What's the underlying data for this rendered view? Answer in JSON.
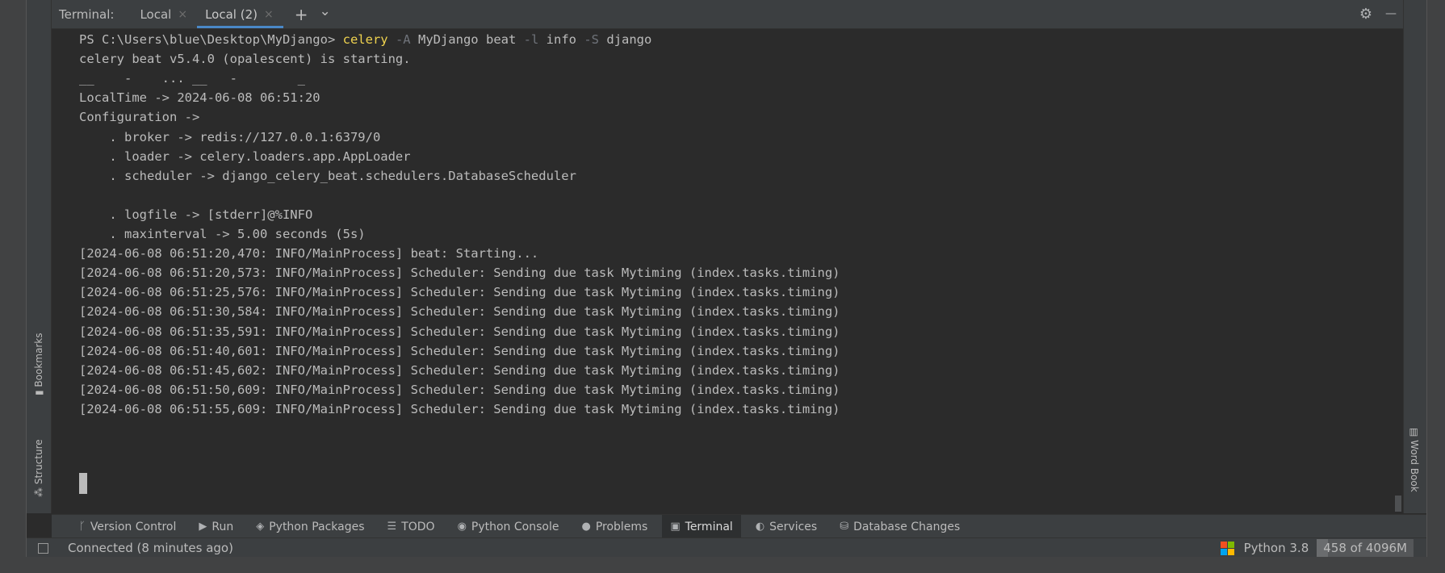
{
  "tabbar": {
    "title": "Terminal:",
    "tabs": [
      {
        "label": "Local",
        "close": "×",
        "active": false
      },
      {
        "label": "Local (2)",
        "close": "×",
        "active": true
      }
    ],
    "add_icon": "+",
    "dropdown_icon": "⌄",
    "settings_icon": "⚙",
    "minimize_icon": "—"
  },
  "side": {
    "bookmarks": "Bookmarks",
    "structure": "Structure",
    "word_book": "Word Book"
  },
  "terminal": {
    "prompt": "PS C:\\Users\\blue\\Desktop\\MyDjango>",
    "cmd": {
      "celery": "celery",
      "flag_a": "-A",
      "app": "MyDjango",
      "beat": "beat",
      "flag_l": "-l",
      "level": "info",
      "flag_s": "-S",
      "sched": "django"
    },
    "lines": [
      "celery beat v5.4.0 (opalescent) is starting.",
      "__    -    ... __   -        _",
      "LocalTime -> 2024-06-08 06:51:20",
      "Configuration ->",
      "    . broker -> redis://127.0.0.1:6379/0",
      "    . loader -> celery.loaders.app.AppLoader",
      "    . scheduler -> django_celery_beat.schedulers.DatabaseScheduler",
      "",
      "    . logfile -> [stderr]@%INFO",
      "    . maxinterval -> 5.00 seconds (5s)",
      "[2024-06-08 06:51:20,470: INFO/MainProcess] beat: Starting...",
      "[2024-06-08 06:51:20,573: INFO/MainProcess] Scheduler: Sending due task Mytiming (index.tasks.timing)",
      "[2024-06-08 06:51:25,576: INFO/MainProcess] Scheduler: Sending due task Mytiming (index.tasks.timing)",
      "[2024-06-08 06:51:30,584: INFO/MainProcess] Scheduler: Sending due task Mytiming (index.tasks.timing)",
      "[2024-06-08 06:51:35,591: INFO/MainProcess] Scheduler: Sending due task Mytiming (index.tasks.timing)",
      "[2024-06-08 06:51:40,601: INFO/MainProcess] Scheduler: Sending due task Mytiming (index.tasks.timing)",
      "[2024-06-08 06:51:45,602: INFO/MainProcess] Scheduler: Sending due task Mytiming (index.tasks.timing)",
      "[2024-06-08 06:51:50,609: INFO/MainProcess] Scheduler: Sending due task Mytiming (index.tasks.timing)",
      "[2024-06-08 06:51:55,609: INFO/MainProcess] Scheduler: Sending due task Mytiming (index.tasks.timing)"
    ]
  },
  "toolbar": {
    "items": [
      {
        "icon": "branch-icon",
        "glyph": "ᚴ",
        "label": "Version Control",
        "active": false
      },
      {
        "icon": "run-icon",
        "glyph": "▶",
        "label": "Run",
        "active": false
      },
      {
        "icon": "packages-icon",
        "glyph": "◈",
        "label": "Python Packages",
        "active": false
      },
      {
        "icon": "todo-icon",
        "glyph": "☰",
        "label": "TODO",
        "active": false
      },
      {
        "icon": "python-console-icon",
        "glyph": "◉",
        "label": "Python Console",
        "active": false
      },
      {
        "icon": "problems-icon",
        "glyph": "●",
        "label": "Problems",
        "active": false
      },
      {
        "icon": "terminal-icon",
        "glyph": "▣",
        "label": "Terminal",
        "active": true
      },
      {
        "icon": "services-icon",
        "glyph": "◐",
        "label": "Services",
        "active": false
      },
      {
        "icon": "database-changes-icon",
        "glyph": "⛁",
        "label": "Database Changes",
        "active": false
      }
    ]
  },
  "status": {
    "connection": "Connected (8 minutes ago)",
    "interpreter": "Python 3.8",
    "memory": "458 of 4096M"
  },
  "colors": {
    "accent": "#4a88c7",
    "command": "#f0d34f",
    "flag": "#6f737a"
  }
}
